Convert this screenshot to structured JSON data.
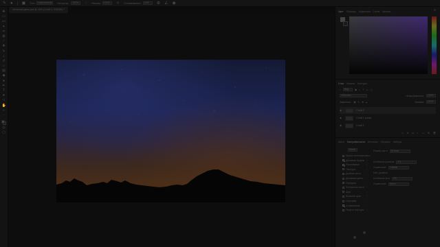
{
  "document": {
    "tab_title": "Нелегкий день.psd @ 25% (Слой 2, RGB/8*) *"
  },
  "options_bar": {
    "items": [
      "Тон:",
      "Нормальный",
      "Непрозр.:",
      "100%",
      "Нажим:",
      "100%",
      "Сглаживание:",
      "10%"
    ]
  },
  "color_panel": {
    "tabs": [
      "Цвет",
      "Образцы",
      "Коррекция",
      "Стили",
      "Каналы"
    ],
    "colors": {
      "field_hue": "#3f2a70",
      "foreground": "#444444",
      "background": "#1a1a1a"
    }
  },
  "layers_panel": {
    "tabs": [
      "Слои",
      "Каналы",
      "Контуры"
    ],
    "filter_label": "Вид",
    "blend_mode": "Обычные",
    "opacity_label": "Непрозрачность:",
    "opacity": "100%",
    "lock_label": "Закрепить:",
    "fill_label": "Заливка:",
    "fill": "100%",
    "layers": [
      {
        "name": "Слой 2",
        "active": true
      },
      {
        "name": "Слой 1 копия",
        "active": false
      },
      {
        "name": "Слой 1",
        "active": false
      }
    ]
  },
  "brush_panel": {
    "tabs": [
      "Кисть",
      "Настройки кисти",
      "Источник",
      "Образцы",
      "Наборы"
    ],
    "presets_button": "Кисти",
    "size_label": "Размер кисти",
    "size_value": "30 пикс.",
    "options": [
      {
        "label": "Форма отпечатка кисти",
        "checked": false
      },
      {
        "label": "Динамика формы",
        "checked": true
      },
      {
        "label": "Рассеивание",
        "checked": true
      },
      {
        "label": "Текстура",
        "checked": false
      },
      {
        "label": "Двойная кисть",
        "checked": false
      },
      {
        "label": "Динамика цвета",
        "checked": false
      },
      {
        "label": "Передача",
        "checked": false
      },
      {
        "label": "Положение кисти",
        "checked": false
      },
      {
        "label": "Шум",
        "checked": false
      },
      {
        "label": "Влажные края",
        "checked": false
      },
      {
        "label": "Аэрограф",
        "checked": false
      },
      {
        "label": "Сглаживание",
        "checked": true
      },
      {
        "label": "Защита текстуры",
        "checked": false
      }
    ],
    "controls": [
      {
        "label": "Колебание размера",
        "value": "0%"
      },
      {
        "label": "Управление:",
        "value": "Нажим"
      },
      {
        "label": "Мин. диаметр",
        "value": ""
      },
      {
        "label": "Колебание угла",
        "value": "0%"
      },
      {
        "label": "Управление:",
        "value": "Выкл."
      }
    ]
  }
}
